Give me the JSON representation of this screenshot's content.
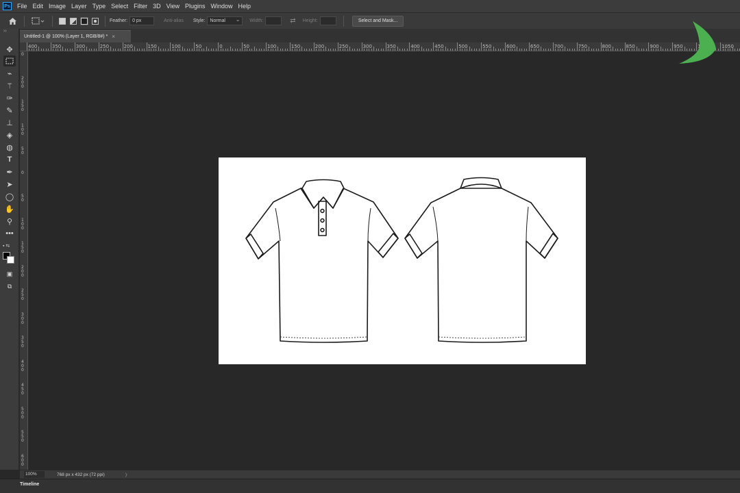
{
  "app": {
    "logo": "Ps"
  },
  "menu": [
    "File",
    "Edit",
    "Image",
    "Layer",
    "Type",
    "Select",
    "Filter",
    "3D",
    "View",
    "Plugins",
    "Window",
    "Help"
  ],
  "options": {
    "feather_label": "Feather:",
    "feather_value": "0 px",
    "antialias_label": "Anti-alias",
    "style_label": "Style:",
    "style_value": "Normal",
    "width_label": "Width:",
    "height_label": "Height:",
    "select_mask_label": "Select and Mask..."
  },
  "document": {
    "tab_title": "Untitled-1 @ 100% (Layer 1, RGB/8#) *",
    "close": "×"
  },
  "ruler": {
    "h_labels": [
      "400",
      "350",
      "300",
      "250",
      "200",
      "150",
      "100",
      "50",
      "0",
      "50",
      "100",
      "150",
      "200",
      "250",
      "300",
      "350",
      "400",
      "450",
      "500",
      "550",
      "600",
      "650",
      "700",
      "750",
      "800",
      "850",
      "900",
      "950",
      "1000",
      "1050"
    ],
    "v_labels": [
      "0",
      "200",
      "150",
      "100",
      "50",
      "0",
      "50",
      "100",
      "150",
      "200",
      "250",
      "300",
      "350",
      "400",
      "450",
      "500",
      "550",
      "600"
    ]
  },
  "status": {
    "zoom": "100%",
    "doc_info": "768 px x 432 px (72 ppi)",
    "arrow": "〉"
  },
  "panels": {
    "timeline": "Timeline"
  },
  "icons": {
    "home": "home-icon",
    "marquee": "rectangular-marquee-icon",
    "move": "move-icon",
    "lasso": "lasso-icon",
    "wand": "magic-wand-icon",
    "eyedropper": "eyedropper-icon",
    "brush": "brush-icon",
    "stamp": "clone-stamp-icon",
    "eraser": "eraser-icon",
    "type": "type-icon",
    "pen": "pen-icon",
    "select": "path-selection-icon",
    "ellipse": "ellipse-icon",
    "hand": "hand-icon",
    "zoom": "zoom-icon"
  },
  "colors": {
    "accent": "#31a8ff",
    "brand_green": "#4caf50",
    "bg": "#282828",
    "panel": "#3c3c3c"
  }
}
